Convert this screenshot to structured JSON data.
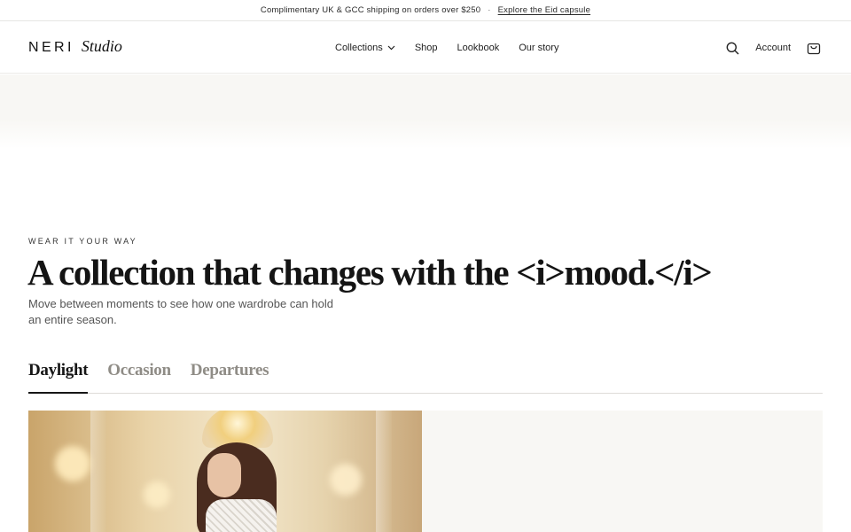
{
  "announcement": {
    "shipping_text": "Complimentary UK & GCC shipping on orders over $250",
    "separator": "·",
    "link_label": "Explore the Eid capsule"
  },
  "brand": {
    "wordmark": "NERI",
    "script": "Studio"
  },
  "nav": {
    "items": [
      {
        "label": "Collections",
        "has_dropdown": true
      },
      {
        "label": "Shop"
      },
      {
        "label": "Lookbook"
      },
      {
        "label": "Our story"
      }
    ]
  },
  "utilities": {
    "search_icon": "search-icon",
    "account_label": "Account",
    "bag_icon": "shopping-bag-icon"
  },
  "hero": {
    "eyebrow": "WEAR IT YOUR WAY",
    "headline": "A collection that changes with the <i>mood.</i>",
    "subcopy": "Move between moments to see how one wardrobe can hold an entire season."
  },
  "tabs": [
    {
      "label": "Daylight",
      "active": true
    },
    {
      "label": "Occasion",
      "active": false
    },
    {
      "label": "Departures",
      "active": false
    }
  ],
  "colors": {
    "text": "#1f1f1f",
    "muted_tab": "#8f8c86",
    "band": "#f8f7f4"
  }
}
